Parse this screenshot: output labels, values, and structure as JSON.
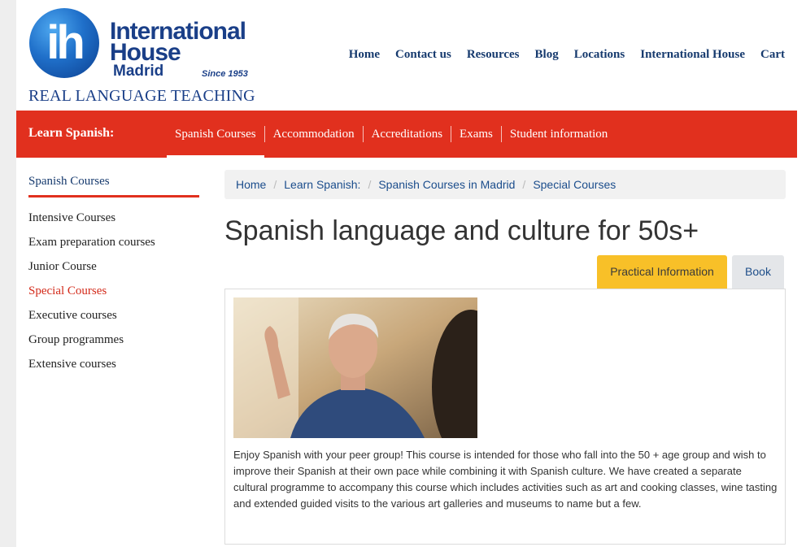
{
  "brand": {
    "logo_mark": "ih",
    "line1": "International",
    "line2": "House",
    "line3": "Madrid",
    "since": "Since 1953",
    "tagline": "REAL LANGUAGE TEACHING",
    "color": "#1a3f88"
  },
  "topnav": [
    "Home",
    "Contact us",
    "Resources",
    "Blog",
    "Locations",
    "International House",
    "Cart"
  ],
  "redbar": {
    "label": "Learn Spanish:",
    "items": [
      "Spanish Courses",
      "Accommodation",
      "Accreditations",
      "Exams",
      "Student information"
    ],
    "active": "Spanish Courses",
    "color": "#e1301e"
  },
  "sidebar": {
    "title": "Spanish Courses",
    "items": [
      "Intensive Courses",
      "Exam preparation courses",
      "Junior Course",
      "Special Courses",
      "Executive courses",
      "Group programmes",
      "Extensive courses"
    ],
    "active": "Special Courses"
  },
  "breadcrumb": [
    "Home",
    "Learn Spanish:",
    "Spanish Courses in Madrid",
    "Special Courses"
  ],
  "page_title": "Spanish language and culture for 50s+",
  "tabs": {
    "practical": "Practical Information",
    "book": "Book",
    "practical_color": "#f8c028"
  },
  "content": {
    "image_alt": "older-man-gesturing-photo",
    "text": "Enjoy Spanish with your peer group!  This course is intended for those who fall into the 50 + age group and wish to improve their Spanish at their own pace while combining it with Spanish culture.  We have created a separate cultural programme to accompany this course which includes activities such as art and cooking classes, wine tasting and extended guided visits to the various art galleries and museums to name but a few."
  }
}
